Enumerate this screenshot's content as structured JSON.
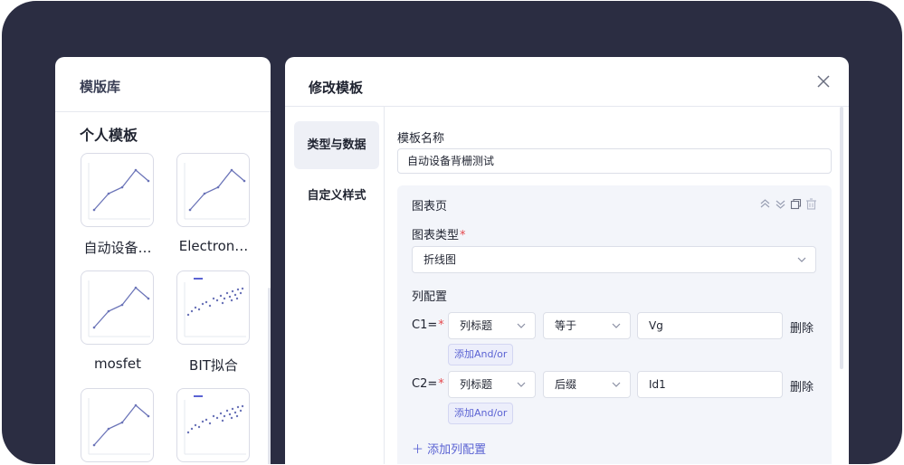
{
  "library": {
    "title": "模版库",
    "section": "个人模板",
    "templates": [
      {
        "label": "自动设备…",
        "kind": "line"
      },
      {
        "label": "Electron…",
        "kind": "line"
      },
      {
        "label": "mosfet",
        "kind": "line"
      },
      {
        "label": "BIT拟合",
        "kind": "scatter"
      },
      {
        "label": "",
        "kind": "line"
      },
      {
        "label": "",
        "kind": "scatter"
      }
    ]
  },
  "dialog": {
    "title": "修改模板",
    "nav": [
      {
        "label": "类型与数据",
        "active": true
      },
      {
        "label": "自定义样式",
        "active": false
      }
    ],
    "template_name_label": "模板名称",
    "template_name_value": "自动设备背栅测试",
    "card": {
      "title": "图表页",
      "chart_type_label": "图表类型",
      "chart_type_value": "折线图",
      "column_config_label": "列配置",
      "rows": [
        {
          "label": "C1=",
          "field": "列标题",
          "operator": "等于",
          "value": "Vg",
          "delete": "删除",
          "andor": "添加And/or"
        },
        {
          "label": "C2=",
          "field": "列标题",
          "operator": "后缀",
          "value": "Id1",
          "delete": "删除",
          "andor": "添加And/or"
        }
      ],
      "add_column": "添加列配置"
    }
  },
  "colors": {
    "frame": "#2b2d42",
    "accent": "#5b63d3",
    "chart_line": "#6b74b8",
    "required": "#e5484d"
  }
}
